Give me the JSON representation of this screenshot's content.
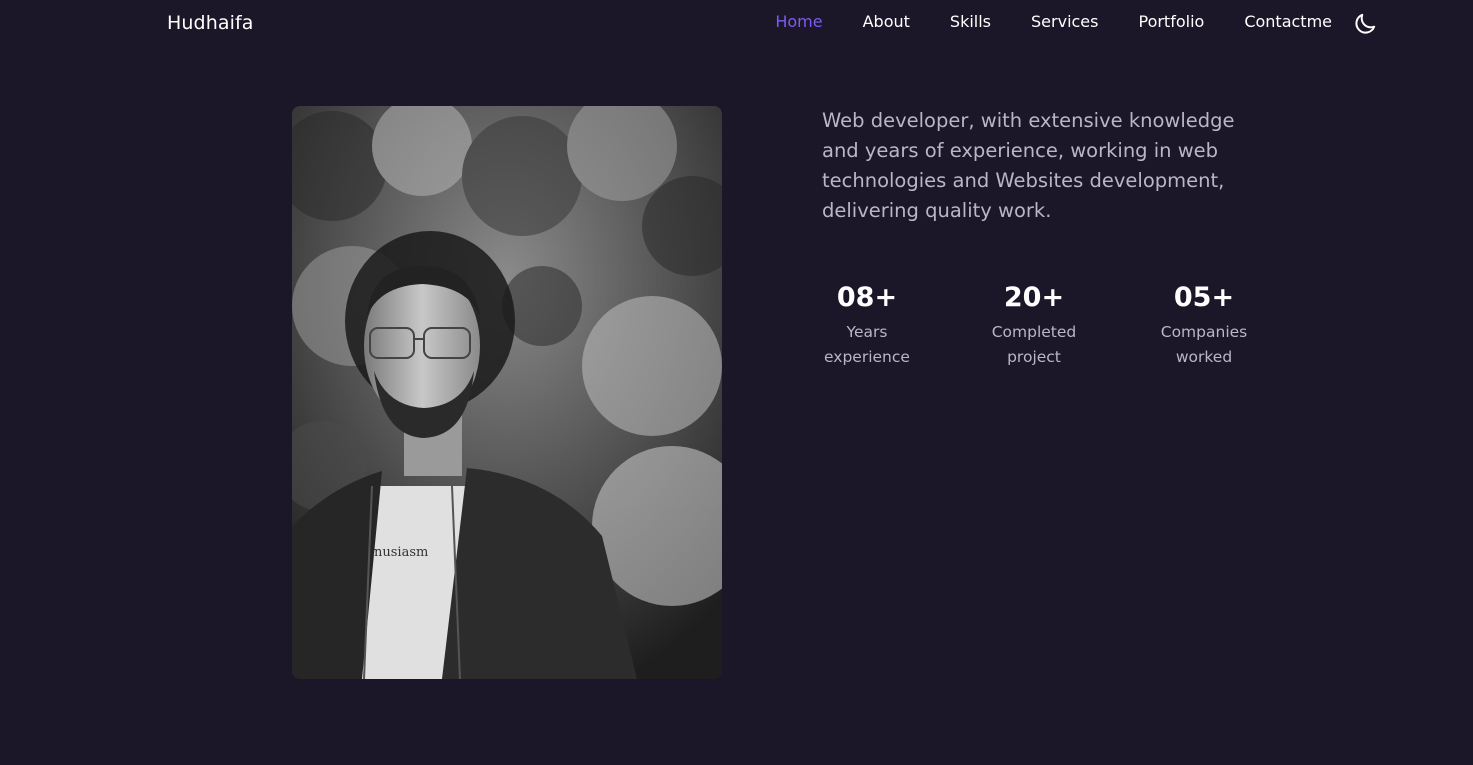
{
  "nav": {
    "logo": "Hudhaifa",
    "links": [
      {
        "label": "Home",
        "active": true
      },
      {
        "label": "About",
        "active": false
      },
      {
        "label": "Skills",
        "active": false
      },
      {
        "label": "Services",
        "active": false
      },
      {
        "label": "Portfolio",
        "active": false
      },
      {
        "label": "Contactme",
        "active": false
      }
    ],
    "theme_toggle_icon": "moon-icon"
  },
  "hero": {
    "photo_icon": "profile-photo",
    "photo_shirt_text": "nusiasm",
    "bio": "Web developer, with extensive knowledge and years of experience, working in web technologies and Websites development, delivering quality work."
  },
  "stats": [
    {
      "value": "08+",
      "label_line1": "Years",
      "label_line2": "experience"
    },
    {
      "value": "20+",
      "label_line1": "Completed",
      "label_line2": "project"
    },
    {
      "value": "05+",
      "label_line1": "Companies",
      "label_line2": "worked"
    }
  ],
  "colors": {
    "background": "#1b1628",
    "accent": "#7b5cf0",
    "text": "#ffffff",
    "muted_text": "#b9b6c6"
  }
}
